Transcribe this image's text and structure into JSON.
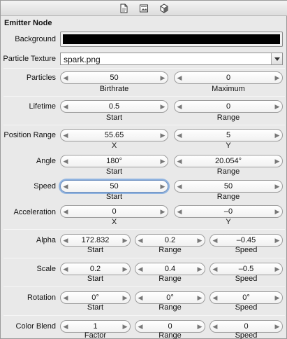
{
  "toolbar": {
    "icons": [
      "document-icon",
      "image-icon",
      "cube-icon"
    ]
  },
  "section_title": "Emitter Node",
  "background": {
    "label": "Background",
    "color": "#000000"
  },
  "texture": {
    "label": "Particle Texture",
    "value": "spark.png"
  },
  "rows": {
    "particles": {
      "label": "Particles",
      "values": [
        "50",
        "0"
      ],
      "subs": [
        "Birthrate",
        "Maximum"
      ]
    },
    "lifetime": {
      "label": "Lifetime",
      "values": [
        "0.5",
        "0"
      ],
      "subs": [
        "Start",
        "Range"
      ]
    },
    "position_range": {
      "label": "Position Range",
      "values": [
        "55.65",
        "5"
      ],
      "subs": [
        "X",
        "Y"
      ]
    },
    "angle": {
      "label": "Angle",
      "values": [
        "180°",
        "20.054°"
      ],
      "subs": [
        "Start",
        "Range"
      ]
    },
    "speed": {
      "label": "Speed",
      "values": [
        "50",
        "50"
      ],
      "subs": [
        "Start",
        "Range"
      ]
    },
    "acceleration": {
      "label": "Acceleration",
      "values": [
        "0",
        "–0"
      ],
      "subs": [
        "X",
        "Y"
      ]
    },
    "alpha": {
      "label": "Alpha",
      "values": [
        "172.832",
        "0.2",
        "–0.45"
      ],
      "subs": [
        "Start",
        "Range",
        "Speed"
      ]
    },
    "scale": {
      "label": "Scale",
      "values": [
        "0.2",
        "0.4",
        "–0.5"
      ],
      "subs": [
        "Start",
        "Range",
        "Speed"
      ]
    },
    "rotation": {
      "label": "Rotation",
      "values": [
        "0°",
        "0°",
        "0°"
      ],
      "subs": [
        "Start",
        "Range",
        "Speed"
      ]
    },
    "color_blend": {
      "label": "Color Blend",
      "values": [
        "1",
        "0",
        "0"
      ],
      "subs": [
        "Factor",
        "Range",
        "Speed"
      ]
    }
  }
}
